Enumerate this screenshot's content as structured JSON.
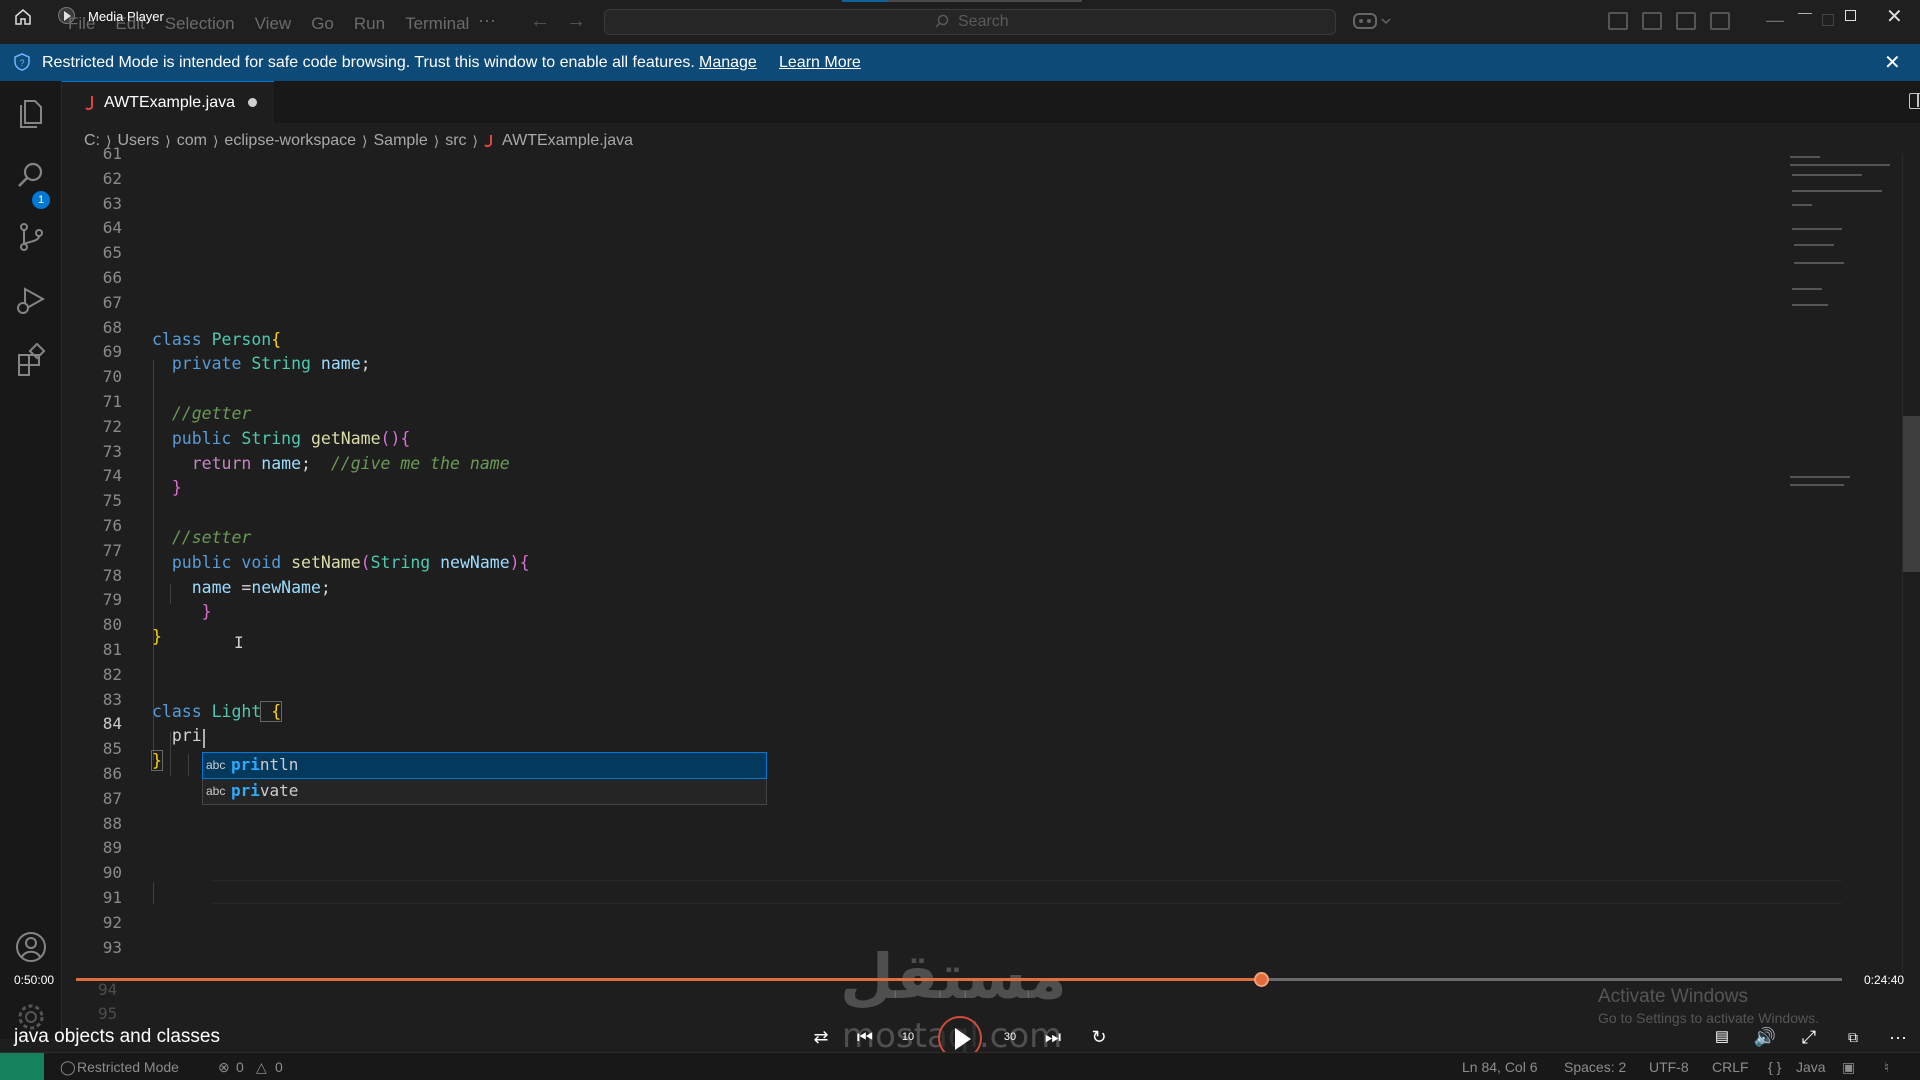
{
  "titlebar": {
    "media_player_title": "Media Player",
    "menu": [
      "File",
      "Edit",
      "Selection",
      "View",
      "Go",
      "Run",
      "Terminal"
    ],
    "menu_more": "···",
    "search_label": "Search"
  },
  "banner": {
    "text": "Restricted Mode is intended for safe code browsing. Trust this window to enable all features.",
    "manage": "Manage",
    "learn_more": "Learn More"
  },
  "activity": {
    "explorer_badge": "1"
  },
  "tab": {
    "label": "AWTExample.java"
  },
  "breadcrumb": [
    "C:",
    "Users",
    "com",
    "eclipse-workspace",
    "Sample",
    "src",
    "AWTExample.java"
  ],
  "editor": {
    "line_numbers": [
      "61",
      "62",
      "63",
      "64",
      "65",
      "66",
      "67",
      "68",
      "69",
      "70",
      "71",
      "72",
      "73",
      "74",
      "75",
      "76",
      "77",
      "78",
      "79",
      "80",
      "81",
      "82",
      "83",
      "84",
      "85",
      "86",
      "87",
      "88",
      "89",
      "90",
      "91",
      "92",
      "93"
    ],
    "ghost_lines": [
      "94",
      "95"
    ],
    "active_line": "84",
    "code": {
      "l68": [
        "class",
        " Person",
        "{"
      ],
      "l69": [
        "private",
        " String",
        " name",
        ";"
      ],
      "l71": "//getter",
      "l72": [
        "public",
        " String",
        " getName",
        "()",
        "{"
      ],
      "l73": [
        "return",
        " name",
        ";",
        "  //give me the name"
      ],
      "l74": "}",
      "l76": "//setter",
      "l77": [
        "public",
        " void",
        " setName",
        "(",
        "String",
        " newName",
        ")",
        "{"
      ],
      "l78": [
        "name",
        " =",
        "newName",
        ";"
      ],
      "l79": "}",
      "l80": "}",
      "l83": [
        "class",
        " Light",
        " {"
      ],
      "l84": "pri",
      "l85": "}"
    }
  },
  "suggest": {
    "items": [
      {
        "kind": "abc",
        "match": "pri",
        "rest": "ntln",
        "selected": true
      },
      {
        "kind": "abc",
        "match": "pri",
        "rest": "vate",
        "selected": false
      }
    ]
  },
  "media": {
    "elapsed": "0:50:00",
    "remaining": "0:24:40",
    "progress": 0.6709,
    "title": "java objects and classes",
    "skip_back": "10",
    "skip_fwd": "30",
    "watermark_ar": "مستقل",
    "watermark_en": "mostaql.com"
  },
  "activate_windows": {
    "line1": "Activate Windows",
    "line2": "Go to Settings to activate Windows."
  },
  "statusbar": {
    "restricted": "Restricted Mode",
    "errors": "0",
    "warnings": "0",
    "position": "Ln 84, Col 6",
    "spaces": "Spaces: 2",
    "encoding": "UTF-8",
    "eol": "CRLF",
    "language": "Java"
  },
  "colors": {
    "accent": "#0078d4",
    "banner": "#0d4a78",
    "progress": "#e26d3a",
    "keyword": "#569cd6",
    "type": "#4ec9b0",
    "comment": "#6a9955"
  }
}
